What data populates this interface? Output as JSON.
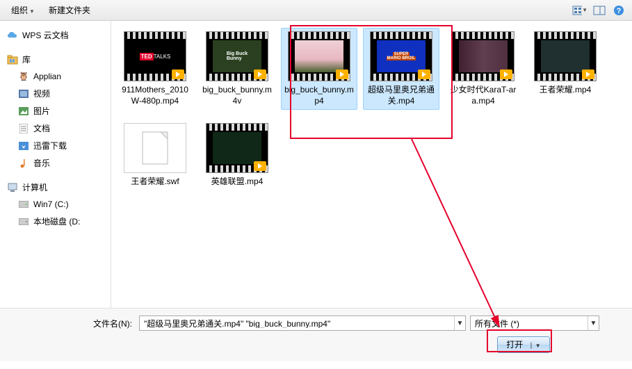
{
  "toolbar": {
    "organize": "组织",
    "new_folder": "新建文件夹"
  },
  "sidebar": {
    "wps": "WPS 云文档",
    "lib": "库",
    "items": [
      {
        "label": "Applian"
      },
      {
        "label": "视频"
      },
      {
        "label": "图片"
      },
      {
        "label": "文档"
      },
      {
        "label": "迅雷下载"
      },
      {
        "label": "音乐"
      }
    ],
    "computer": "计算机",
    "drives": [
      {
        "label": "Win7 (C:)"
      },
      {
        "label": "本地磁盘 (D:"
      }
    ]
  },
  "files": [
    {
      "name": "911Mothers_2010W-480p.mp4",
      "type": "video",
      "thumb": "ted"
    },
    {
      "name": "big_buck_bunny.m4v",
      "type": "video",
      "thumb": "bbb"
    },
    {
      "name": "big_buck_bunny.mp4",
      "type": "video",
      "selected": true,
      "thumb": "bbb2"
    },
    {
      "name": "超级马里奥兄弟通关.mp4",
      "type": "video",
      "selected": true,
      "thumb": "mario"
    },
    {
      "name": "少女时代KaraT-ara.mp4",
      "type": "video",
      "thumb": "kpop"
    },
    {
      "name": "王者荣耀.mp4",
      "type": "video",
      "thumb": "game"
    },
    {
      "name": "王者荣耀.swf",
      "type": "swf"
    },
    {
      "name": "英雄联盟.mp4",
      "type": "video",
      "thumb": "lol"
    }
  ],
  "bottom": {
    "filename_label": "文件名(N):",
    "filename_value": "\"超级马里奥兄弟通关.mp4\" \"big_buck_bunny.mp4\"",
    "filter": "所有文件 (*)",
    "open": "打开"
  }
}
